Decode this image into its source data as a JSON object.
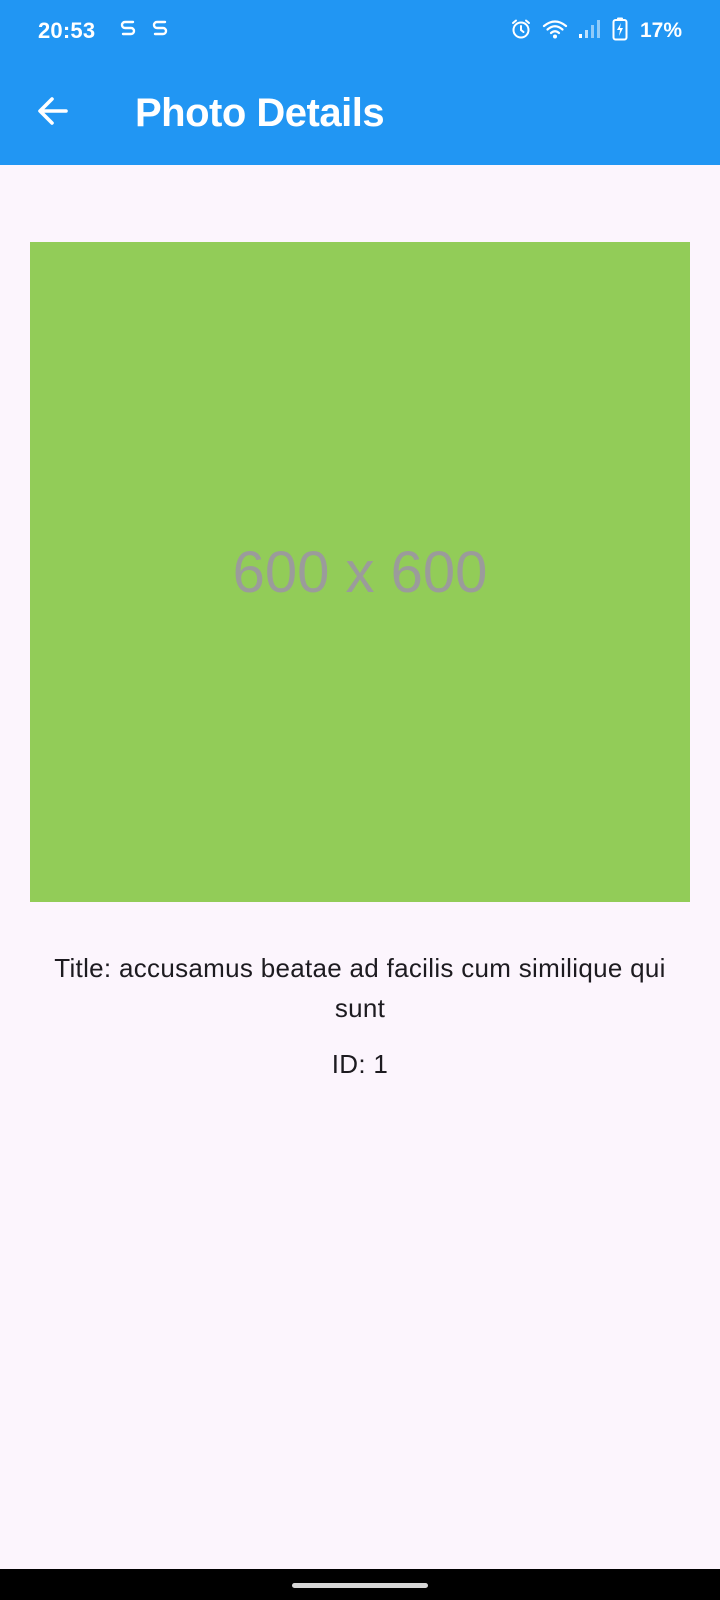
{
  "status_bar": {
    "time": "20:53",
    "left_icons": [
      "sync-icon",
      "sync-icon"
    ],
    "right_icons": [
      "alarm-icon",
      "wifi-icon",
      "signal-icon",
      "battery-charging-icon"
    ],
    "battery_percent": "17%"
  },
  "app_bar": {
    "back_icon": "arrow-back-icon",
    "title": "Photo Details",
    "color": "#2196f3"
  },
  "photo": {
    "placeholder_text": "600 x 600",
    "color": "#92cc58"
  },
  "details": {
    "title": "Title: accusamus beatae ad facilis cum similique qui sunt",
    "id": "ID: 1"
  }
}
